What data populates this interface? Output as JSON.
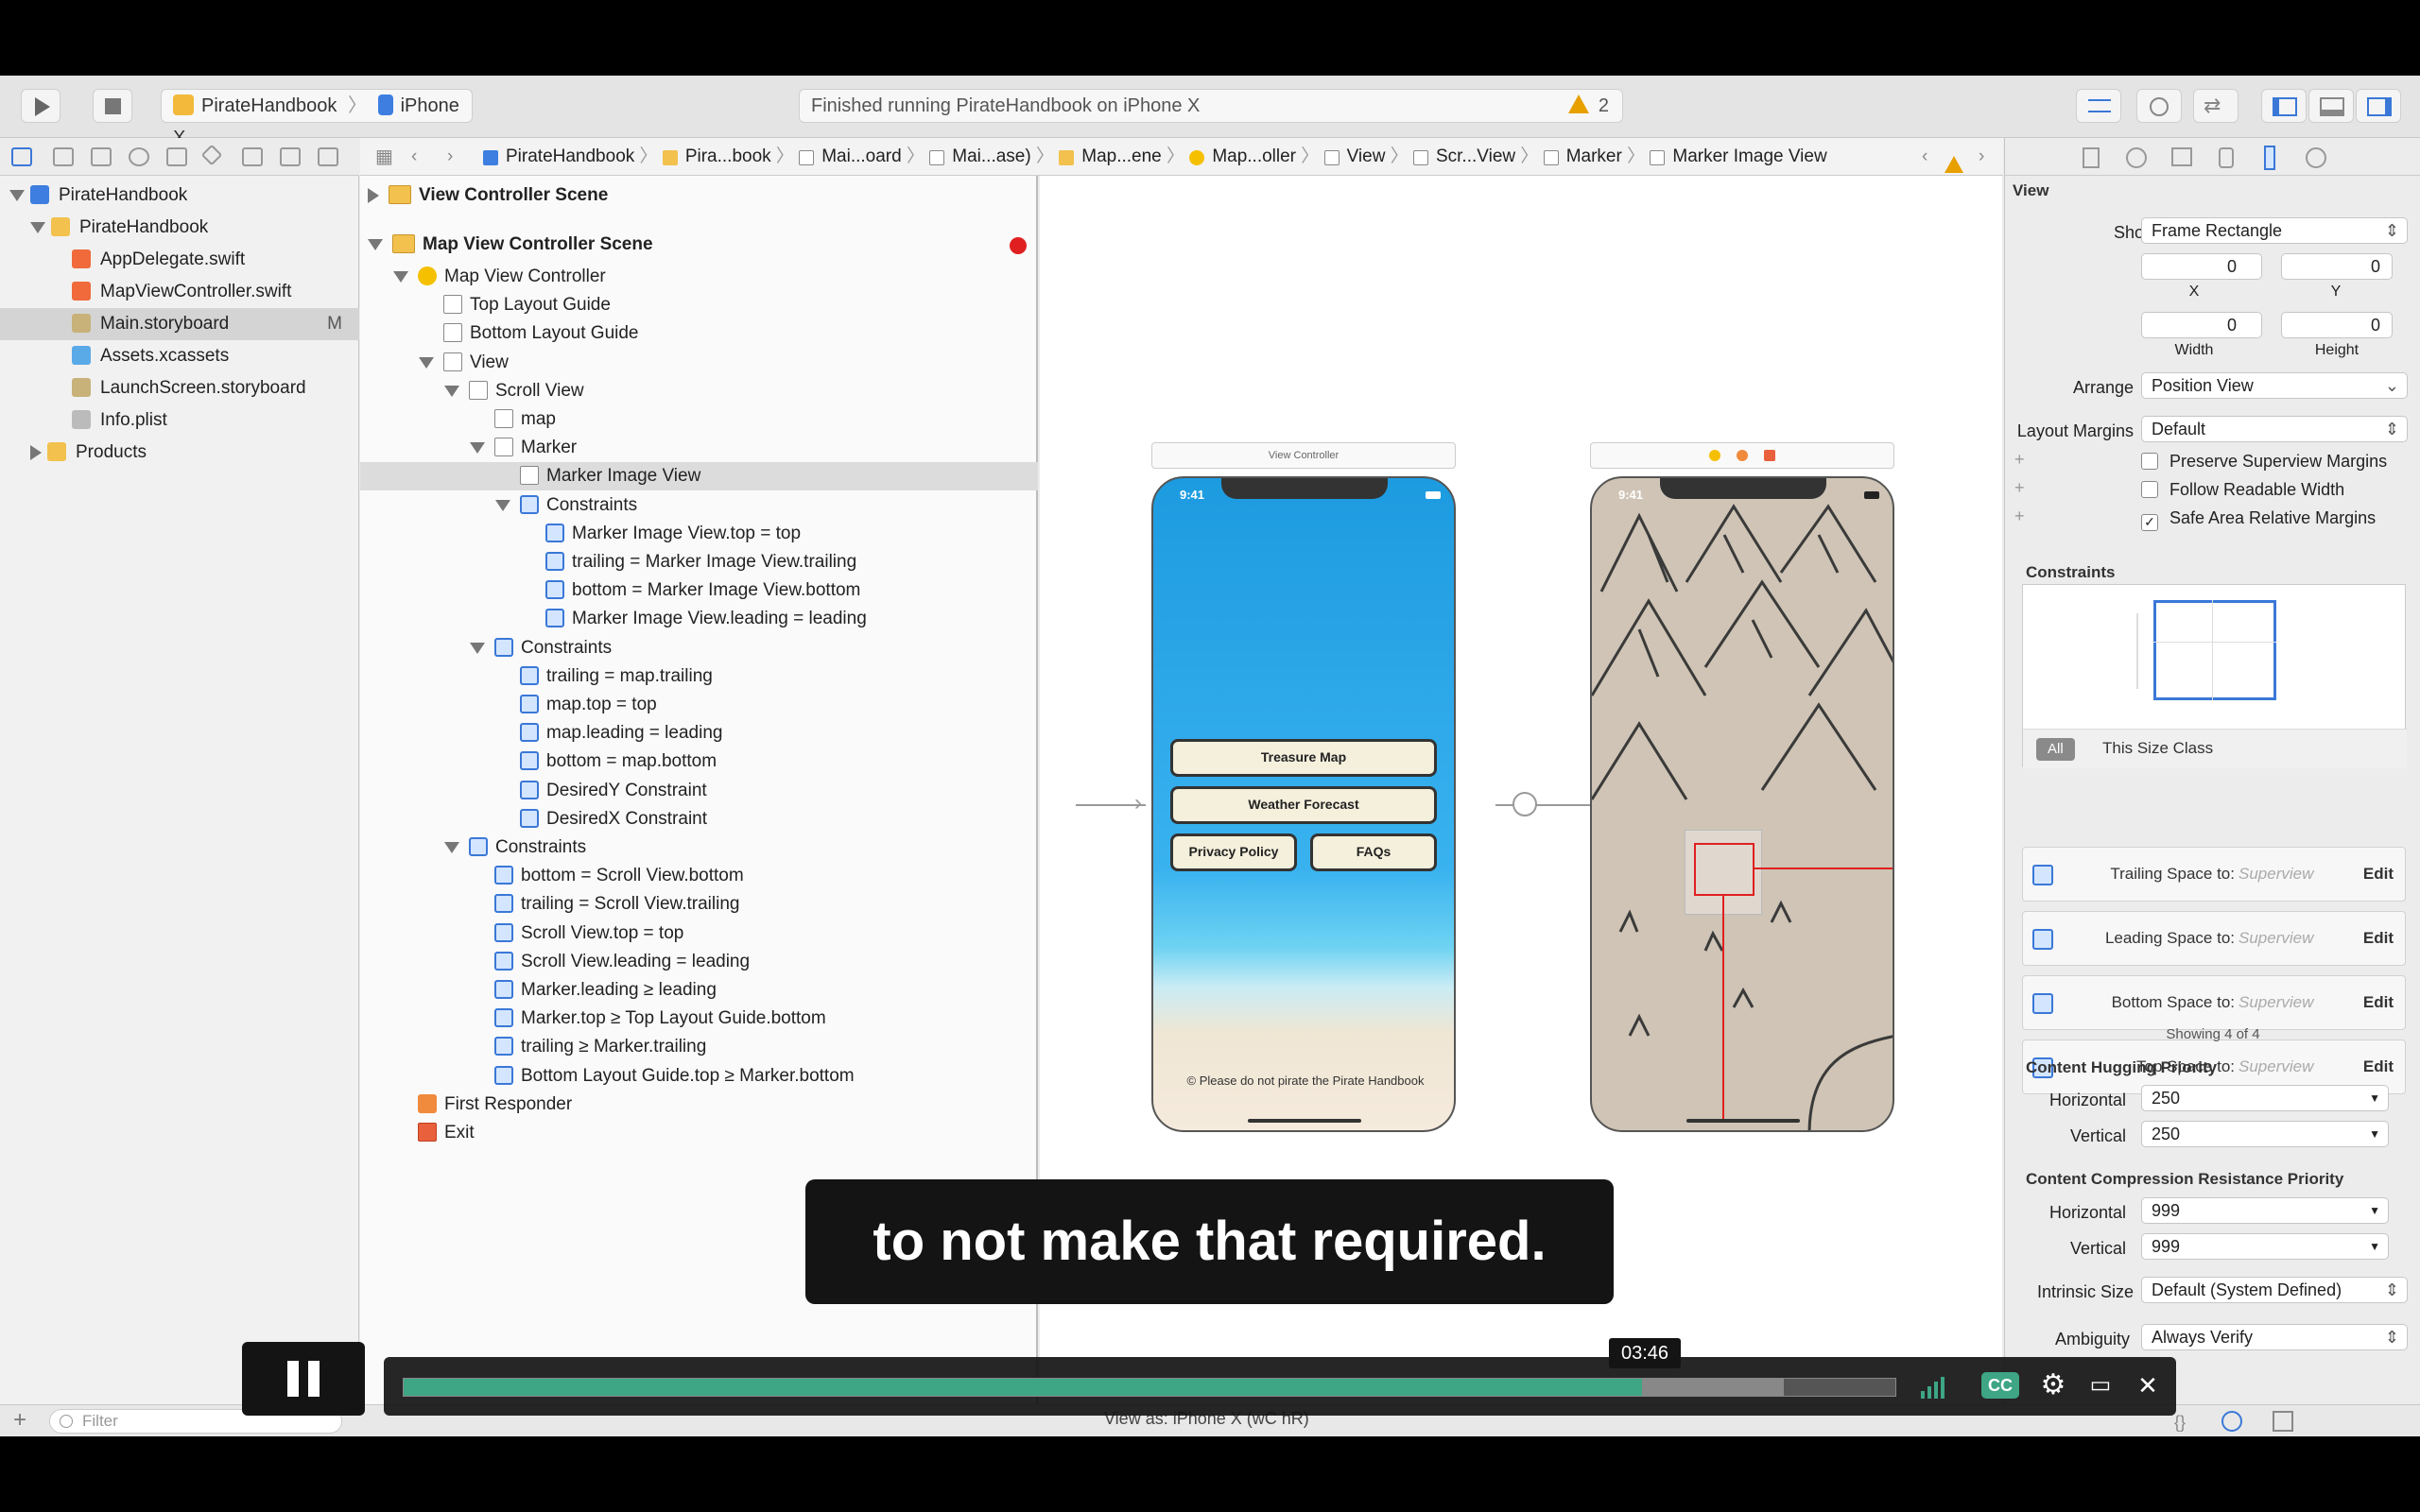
{
  "toolbar": {
    "run_icon": "play-icon",
    "stop_icon": "stop-icon",
    "scheme": "PirateHandbook",
    "device": "iPhone X",
    "activity": "Finished running PirateHandbook on iPhone X",
    "warnings": "2"
  },
  "navigator": {
    "items": [
      {
        "label": "PirateHandbook",
        "level": 0,
        "expanded": true,
        "icon": "project-icon"
      },
      {
        "label": "PirateHandbook",
        "level": 1,
        "expanded": true,
        "icon": "folder-icon"
      },
      {
        "label": "AppDelegate.swift",
        "level": 2,
        "icon": "swift-file-icon"
      },
      {
        "label": "MapViewController.swift",
        "level": 2,
        "icon": "swift-file-icon"
      },
      {
        "label": "Main.storyboard",
        "level": 2,
        "icon": "storyboard-icon",
        "selected": true,
        "badge": "M"
      },
      {
        "label": "Assets.xcassets",
        "level": 2,
        "icon": "assets-icon"
      },
      {
        "label": "LaunchScreen.storyboard",
        "level": 2,
        "icon": "storyboard-icon"
      },
      {
        "label": "Info.plist",
        "level": 2,
        "icon": "plist-icon"
      },
      {
        "label": "Products",
        "level": 1,
        "expanded": false,
        "icon": "folder-icon"
      }
    ],
    "filter_placeholder": "Filter"
  },
  "jumpbar": {
    "crumbs": [
      "PirateHandbook",
      "Pira...book",
      "Mai...oard",
      "Mai...ase)",
      "Map...ene",
      "Map...oller",
      "View",
      "Scr...View",
      "Marker",
      "Marker Image View"
    ]
  },
  "outline": {
    "rows": [
      {
        "label": "View Controller Scene",
        "level": 0,
        "type": "scene",
        "expanded": false,
        "bold": true
      },
      {
        "label": "Map View Controller Scene",
        "level": 0,
        "type": "scene",
        "expanded": true,
        "bold": true,
        "error": true
      },
      {
        "label": "Map View Controller",
        "level": 1,
        "type": "vc",
        "expanded": true
      },
      {
        "label": "Top Layout Guide",
        "level": 2,
        "type": "view"
      },
      {
        "label": "Bottom Layout Guide",
        "level": 2,
        "type": "view"
      },
      {
        "label": "View",
        "level": 2,
        "type": "view",
        "expanded": true
      },
      {
        "label": "Scroll View",
        "level": 3,
        "type": "view",
        "expanded": true
      },
      {
        "label": "map",
        "level": 4,
        "type": "view"
      },
      {
        "label": "Marker",
        "level": 4,
        "type": "view",
        "expanded": true
      },
      {
        "label": "Marker Image View",
        "level": 5,
        "type": "view",
        "selected": true
      },
      {
        "label": "Constraints",
        "level": 5,
        "type": "constraint",
        "expanded": true
      },
      {
        "label": "Marker Image View.top = top",
        "level": 6,
        "type": "constraint"
      },
      {
        "label": "trailing = Marker Image View.trailing",
        "level": 6,
        "type": "constraint"
      },
      {
        "label": "bottom = Marker Image View.bottom",
        "level": 6,
        "type": "constraint"
      },
      {
        "label": "Marker Image View.leading = leading",
        "level": 6,
        "type": "constraint"
      },
      {
        "label": "Constraints",
        "level": 4,
        "type": "constraint",
        "expanded": true
      },
      {
        "label": "trailing = map.trailing",
        "level": 5,
        "type": "constraint"
      },
      {
        "label": "map.top = top",
        "level": 5,
        "type": "constraint"
      },
      {
        "label": "map.leading = leading",
        "level": 5,
        "type": "constraint"
      },
      {
        "label": "bottom = map.bottom",
        "level": 5,
        "type": "constraint"
      },
      {
        "label": "DesiredY Constraint",
        "level": 5,
        "type": "constraint"
      },
      {
        "label": "DesiredX Constraint",
        "level": 5,
        "type": "constraint"
      },
      {
        "label": "Constraints",
        "level": 3,
        "type": "constraint",
        "expanded": true
      },
      {
        "label": "bottom = Scroll View.bottom",
        "level": 4,
        "type": "constraint"
      },
      {
        "label": "trailing = Scroll View.trailing",
        "level": 4,
        "type": "constraint"
      },
      {
        "label": "Scroll View.top = top",
        "level": 4,
        "type": "constraint"
      },
      {
        "label": "Scroll View.leading = leading",
        "level": 4,
        "type": "constraint"
      },
      {
        "label": "Marker.leading ≥ leading",
        "level": 4,
        "type": "constraint"
      },
      {
        "label": "Marker.top ≥ Top Layout Guide.bottom",
        "level": 4,
        "type": "constraint"
      },
      {
        "label": "trailing ≥ Marker.trailing",
        "level": 4,
        "type": "constraint"
      },
      {
        "label": "Bottom Layout Guide.top ≥ Marker.bottom",
        "level": 4,
        "type": "constraint"
      },
      {
        "label": "First Responder",
        "level": 1,
        "type": "responder"
      },
      {
        "label": "Exit",
        "level": 1,
        "type": "exit"
      }
    ]
  },
  "canvas": {
    "vc_title": "View Controller",
    "phone_time": "9:41",
    "btn_treasure": "Treasure Map",
    "btn_weather": "Weather Forecast",
    "btn_privacy": "Privacy Policy",
    "btn_faqs": "FAQs",
    "footer": "© Please do not pirate the Pirate Handbook",
    "map_time": "9:41"
  },
  "inspector": {
    "section_view": "View",
    "show_label": "Show",
    "show_value": "Frame Rectangle",
    "x_value": "0",
    "y_value": "0",
    "x_label": "X",
    "y_label": "Y",
    "width_value": "0",
    "height_value": "0",
    "width_label": "Width",
    "height_label": "Height",
    "arrange_label": "Arrange",
    "arrange_value": "Position View",
    "layout_margins_label": "Layout Margins",
    "layout_margins_value": "Default",
    "cb_preserve": "Preserve Superview Margins",
    "cb_readable": "Follow Readable Width",
    "cb_safe": "Safe Area Relative Margins",
    "constraints_head": "Constraints",
    "seg_all": "All",
    "seg_size_class": "This Size Class",
    "constraint_cards": [
      {
        "label": "Trailing Space to:",
        "target": "Superview",
        "edit": "Edit"
      },
      {
        "label": "Leading Space to:",
        "target": "Superview",
        "edit": "Edit"
      },
      {
        "label": "Bottom Space to:",
        "target": "Superview",
        "edit": "Edit"
      },
      {
        "label": "Top Space to:",
        "target": "Superview",
        "edit": "Edit"
      }
    ],
    "showing": "Showing 4 of 4",
    "hugging_head": "Content Hugging Priority",
    "hug_h_label": "Horizontal",
    "hug_h_value": "250",
    "hug_v_label": "Vertical",
    "hug_v_value": "250",
    "compression_head": "Content Compression Resistance Priority",
    "comp_h_label": "Horizontal",
    "comp_h_value": "999",
    "comp_v_label": "Vertical",
    "comp_v_value": "999",
    "intrinsic_label": "Intrinsic Size",
    "intrinsic_value": "Default (System Defined)",
    "ambiguity_label": "Ambiguity",
    "ambiguity_value": "Always Verify"
  },
  "bottombar": {
    "view_as": "View as: iPhone X (wC hR)"
  },
  "player": {
    "subtitle": "to not make that required.",
    "time": "03:46",
    "progress": 0.83,
    "buffered": 0.925
  }
}
